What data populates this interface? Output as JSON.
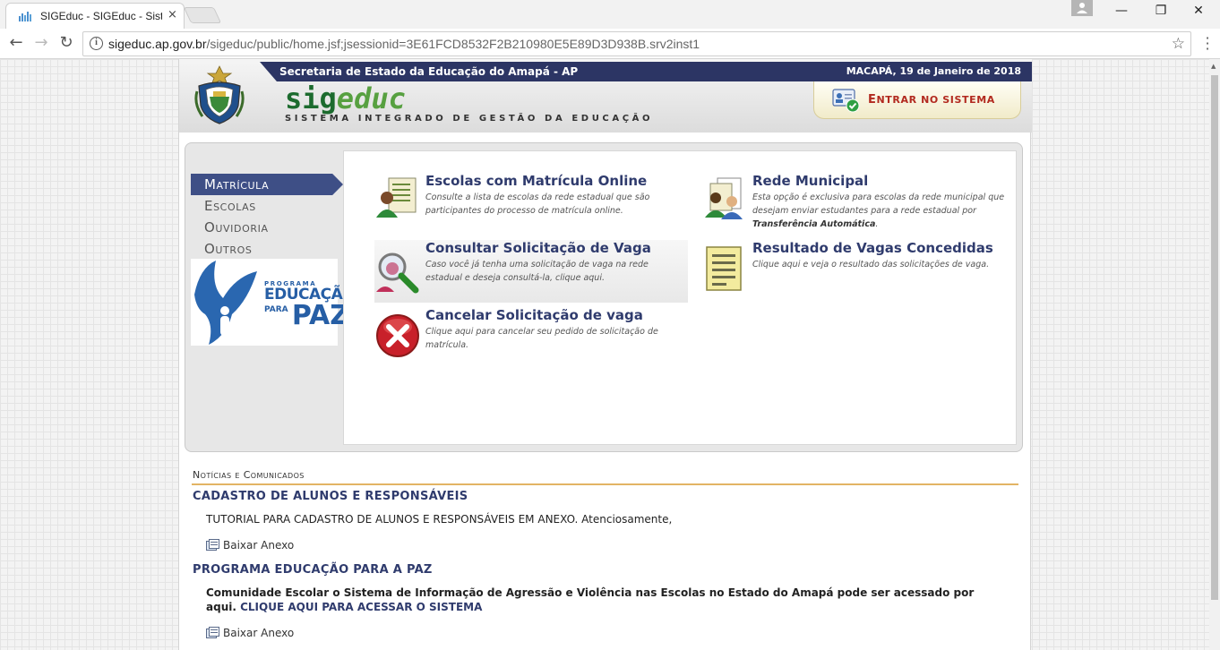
{
  "browser": {
    "tab_title": "SIGEduc - SIGEduc - Siste",
    "tab_close": "×",
    "url_host": "sigeduc.ap.gov.br",
    "url_path": "/sigeduc/public/home.jsf;jsessionid=3E61FCD8532F2B210980E5E89D3D938B.srv2inst1",
    "info_glyph": "i",
    "star_glyph": "☆",
    "back_glyph": "←",
    "forward_glyph": "→",
    "reload_glyph": "↻",
    "minimize_glyph": "—",
    "restore_glyph": "❐",
    "close_glyph": "✕",
    "icons": [
      "favicon-icon",
      "info-icon",
      "star-icon",
      "menu-dots-icon"
    ]
  },
  "header": {
    "secretaria": "Secretaria de Estado da Educação do Amapá - AP",
    "date": "MACAPÁ, 19 de Janeiro de 2018",
    "logo_sig": "sig",
    "logo_educ": "educ",
    "logo_subtitle": "SISTEMA INTEGRADO DE GESTÃO DA EDUCAÇÃO",
    "login_first": "E",
    "login_rest": "NTRAR NO SISTEMA",
    "colors": {
      "bar": "#2c3564",
      "login_text": "#b2291f",
      "logo_green": "#1c6b2e"
    }
  },
  "sidebar": {
    "items": [
      {
        "label": "Matrícula",
        "active": true
      },
      {
        "label": "Escolas",
        "active": false
      },
      {
        "label": "Ouvidoria",
        "active": false
      },
      {
        "label": "Outros",
        "active": false
      }
    ],
    "banner": {
      "small": "PROGRAMA",
      "edu": "EDUCAÇÃO",
      "para": "PARA",
      "paz": "PAZ"
    }
  },
  "options": [
    {
      "title": "Escolas com Matrícula Online",
      "desc": "Consulte a lista de escolas da rede estadual que são participantes do processo de matrícula online.",
      "icon": "student-list-icon"
    },
    {
      "title": "Rede Municipal",
      "desc": "Esta opção é exclusiva para escolas da rede municipal que desejam enviar estudantes para a rede estadual por ",
      "desc_bold": "Transferência Automática",
      "desc_end": ".",
      "icon": "students-transfer-icon"
    },
    {
      "title": "Consultar Solicitação de Vaga",
      "desc": "Caso você já tenha uma solicitação de vaga na rede estadual e deseja consultá-la, clique aqui.",
      "icon": "magnifier-icon"
    },
    {
      "title": "Resultado de Vagas Concedidas",
      "desc": "Clique aqui e veja o resultado das solicitações de vaga.",
      "icon": "document-list-icon"
    },
    {
      "title": "Cancelar Solicitação de vaga",
      "desc": "Clique aqui para cancelar seu pedido de solicitação de matrícula.",
      "icon": "cancel-icon"
    }
  ],
  "news": {
    "heading": "Notícias e Comunicados",
    "items": [
      {
        "title": "CADASTRO DE ALUNOS E RESPONSÁVEIS",
        "body": "TUTORIAL PARA CADASTRO DE ALUNOS E RESPONSÁVEIS EM ANEXO. Atenciosamente,",
        "attachment": "Baixar Anexo"
      },
      {
        "title": "PROGRAMA EDUCAÇÃO PARA A PAZ",
        "body": "Comunidade Escolar o Sistema de Informação de Agressão e Violência nas Escolas no Estado do Amapá pode ser acessado por aqui. ",
        "link": "CLIQUE AQUI PARA ACESSAR O SISTEMA",
        "attachment": "Baixar Anexo"
      }
    ],
    "accent": "#e2b464"
  }
}
